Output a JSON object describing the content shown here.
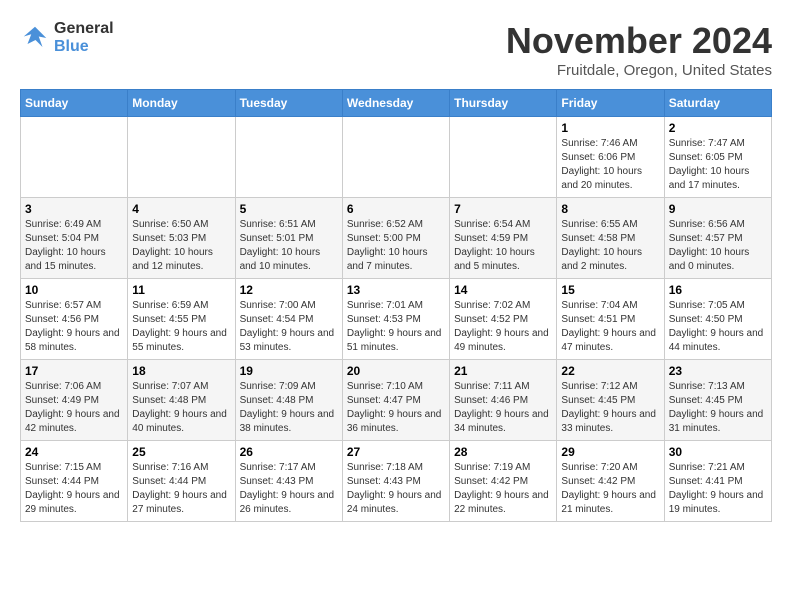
{
  "header": {
    "logo": {
      "line1": "General",
      "line2": "Blue"
    },
    "title": "November 2024",
    "location": "Fruitdale, Oregon, United States"
  },
  "weekdays": [
    "Sunday",
    "Monday",
    "Tuesday",
    "Wednesday",
    "Thursday",
    "Friday",
    "Saturday"
  ],
  "weeks": [
    [
      {
        "day": "",
        "info": ""
      },
      {
        "day": "",
        "info": ""
      },
      {
        "day": "",
        "info": ""
      },
      {
        "day": "",
        "info": ""
      },
      {
        "day": "",
        "info": ""
      },
      {
        "day": "1",
        "info": "Sunrise: 7:46 AM\nSunset: 6:06 PM\nDaylight: 10 hours and 20 minutes."
      },
      {
        "day": "2",
        "info": "Sunrise: 7:47 AM\nSunset: 6:05 PM\nDaylight: 10 hours and 17 minutes."
      }
    ],
    [
      {
        "day": "3",
        "info": "Sunrise: 6:49 AM\nSunset: 5:04 PM\nDaylight: 10 hours and 15 minutes."
      },
      {
        "day": "4",
        "info": "Sunrise: 6:50 AM\nSunset: 5:03 PM\nDaylight: 10 hours and 12 minutes."
      },
      {
        "day": "5",
        "info": "Sunrise: 6:51 AM\nSunset: 5:01 PM\nDaylight: 10 hours and 10 minutes."
      },
      {
        "day": "6",
        "info": "Sunrise: 6:52 AM\nSunset: 5:00 PM\nDaylight: 10 hours and 7 minutes."
      },
      {
        "day": "7",
        "info": "Sunrise: 6:54 AM\nSunset: 4:59 PM\nDaylight: 10 hours and 5 minutes."
      },
      {
        "day": "8",
        "info": "Sunrise: 6:55 AM\nSunset: 4:58 PM\nDaylight: 10 hours and 2 minutes."
      },
      {
        "day": "9",
        "info": "Sunrise: 6:56 AM\nSunset: 4:57 PM\nDaylight: 10 hours and 0 minutes."
      }
    ],
    [
      {
        "day": "10",
        "info": "Sunrise: 6:57 AM\nSunset: 4:56 PM\nDaylight: 9 hours and 58 minutes."
      },
      {
        "day": "11",
        "info": "Sunrise: 6:59 AM\nSunset: 4:55 PM\nDaylight: 9 hours and 55 minutes."
      },
      {
        "day": "12",
        "info": "Sunrise: 7:00 AM\nSunset: 4:54 PM\nDaylight: 9 hours and 53 minutes."
      },
      {
        "day": "13",
        "info": "Sunrise: 7:01 AM\nSunset: 4:53 PM\nDaylight: 9 hours and 51 minutes."
      },
      {
        "day": "14",
        "info": "Sunrise: 7:02 AM\nSunset: 4:52 PM\nDaylight: 9 hours and 49 minutes."
      },
      {
        "day": "15",
        "info": "Sunrise: 7:04 AM\nSunset: 4:51 PM\nDaylight: 9 hours and 47 minutes."
      },
      {
        "day": "16",
        "info": "Sunrise: 7:05 AM\nSunset: 4:50 PM\nDaylight: 9 hours and 44 minutes."
      }
    ],
    [
      {
        "day": "17",
        "info": "Sunrise: 7:06 AM\nSunset: 4:49 PM\nDaylight: 9 hours and 42 minutes."
      },
      {
        "day": "18",
        "info": "Sunrise: 7:07 AM\nSunset: 4:48 PM\nDaylight: 9 hours and 40 minutes."
      },
      {
        "day": "19",
        "info": "Sunrise: 7:09 AM\nSunset: 4:48 PM\nDaylight: 9 hours and 38 minutes."
      },
      {
        "day": "20",
        "info": "Sunrise: 7:10 AM\nSunset: 4:47 PM\nDaylight: 9 hours and 36 minutes."
      },
      {
        "day": "21",
        "info": "Sunrise: 7:11 AM\nSunset: 4:46 PM\nDaylight: 9 hours and 34 minutes."
      },
      {
        "day": "22",
        "info": "Sunrise: 7:12 AM\nSunset: 4:45 PM\nDaylight: 9 hours and 33 minutes."
      },
      {
        "day": "23",
        "info": "Sunrise: 7:13 AM\nSunset: 4:45 PM\nDaylight: 9 hours and 31 minutes."
      }
    ],
    [
      {
        "day": "24",
        "info": "Sunrise: 7:15 AM\nSunset: 4:44 PM\nDaylight: 9 hours and 29 minutes."
      },
      {
        "day": "25",
        "info": "Sunrise: 7:16 AM\nSunset: 4:44 PM\nDaylight: 9 hours and 27 minutes."
      },
      {
        "day": "26",
        "info": "Sunrise: 7:17 AM\nSunset: 4:43 PM\nDaylight: 9 hours and 26 minutes."
      },
      {
        "day": "27",
        "info": "Sunrise: 7:18 AM\nSunset: 4:43 PM\nDaylight: 9 hours and 24 minutes."
      },
      {
        "day": "28",
        "info": "Sunrise: 7:19 AM\nSunset: 4:42 PM\nDaylight: 9 hours and 22 minutes."
      },
      {
        "day": "29",
        "info": "Sunrise: 7:20 AM\nSunset: 4:42 PM\nDaylight: 9 hours and 21 minutes."
      },
      {
        "day": "30",
        "info": "Sunrise: 7:21 AM\nSunset: 4:41 PM\nDaylight: 9 hours and 19 minutes."
      }
    ]
  ]
}
